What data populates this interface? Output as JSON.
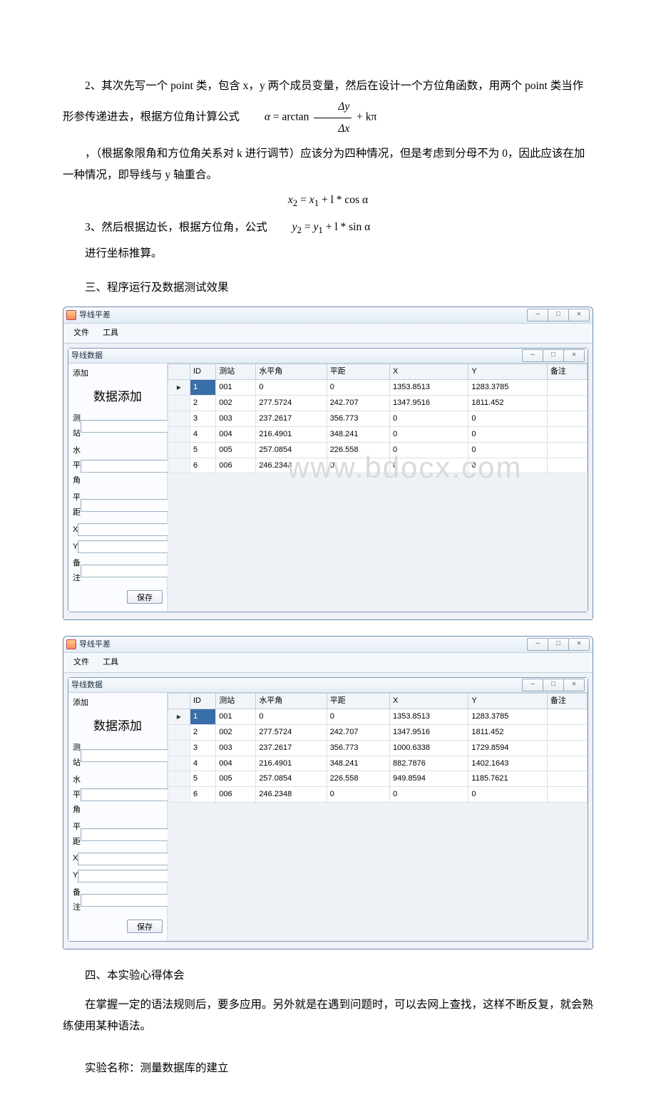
{
  "para": {
    "p1_lead": "2、其次先写一个 point 类，包含 x，y 两个成员变量，然后在设计一个方位角函数，用两个 point 类当作形参传递进去，根据方位角计算公式",
    "p1_tail": "",
    "p2": "，（根据象限角和方位角关系对 k 进行调节）应该分为四种情况，但是考虑到分母不为 0，因此应该在加一种情况，即导线与 y 轴重合。",
    "p3_lead": "3、然后根据边长，根据方位角，公式",
    "p4": "进行坐标推算。",
    "h3": "三、程序运行及数据测试效果",
    "h4": "四、本实验心得体会",
    "p5": "在掌握一定的语法规则后，要多应用。另外就是在遇到问题时，可以去网上查找，这样不断反复，就会熟练使用某种语法。",
    "p6": "实验名称：测量数据库的建立"
  },
  "formula": {
    "azimuth_lhs": "α",
    "azimuth_op": "= arctan",
    "dy": "Δy",
    "dx": "Δx",
    "kpi": "+ kπ",
    "x2": "x",
    "sub2": "2",
    "eq": " = ",
    "x1": "x",
    "sub1": "1",
    "plus_l": " + l * ",
    "cosA": "cos α",
    "y2": "y",
    "y1": "y",
    "sinA": "sin α"
  },
  "app": {
    "main_title": "导线平差",
    "menu_file": "文件",
    "menu_tool": "工具",
    "child_title": "导线数据",
    "side_add": "添加",
    "side_big": "数据添加",
    "lbl_station": "测站",
    "lbl_hang": "水平角",
    "lbl_dist": "平距",
    "lbl_x": "X",
    "lbl_y": "Y",
    "lbl_note": "备注",
    "save": "保存",
    "watermark": "www.bdocx.com"
  },
  "cols": [
    "ID",
    "测站",
    "水平角",
    "平距",
    "X",
    "Y",
    "备注"
  ],
  "rows1": [
    {
      "id": "1",
      "st": "001",
      "h": "0",
      "d": "0",
      "x": "1353.8513",
      "y": "1283.3785",
      "n": ""
    },
    {
      "id": "2",
      "st": "002",
      "h": "277.5724",
      "d": "242.707",
      "x": "1347.9516",
      "y": "1811.452",
      "n": ""
    },
    {
      "id": "3",
      "st": "003",
      "h": "237.2617",
      "d": "356.773",
      "x": "0",
      "y": "0",
      "n": ""
    },
    {
      "id": "4",
      "st": "004",
      "h": "216.4901",
      "d": "348.241",
      "x": "0",
      "y": "0",
      "n": ""
    },
    {
      "id": "5",
      "st": "005",
      "h": "257.0854",
      "d": "226.558",
      "x": "0",
      "y": "0",
      "n": ""
    },
    {
      "id": "6",
      "st": "006",
      "h": "246.2348",
      "d": "0",
      "x": "0",
      "y": "0",
      "n": ""
    }
  ],
  "rows2": [
    {
      "id": "1",
      "st": "001",
      "h": "0",
      "d": "0",
      "x": "1353.8513",
      "y": "1283.3785",
      "n": ""
    },
    {
      "id": "2",
      "st": "002",
      "h": "277.5724",
      "d": "242.707",
      "x": "1347.9516",
      "y": "1811.452",
      "n": ""
    },
    {
      "id": "3",
      "st": "003",
      "h": "237.2617",
      "d": "356.773",
      "x": "1000.6338",
      "y": "1729.8594",
      "n": ""
    },
    {
      "id": "4",
      "st": "004",
      "h": "216.4901",
      "d": "348.241",
      "x": "882.7876",
      "y": "1402.1643",
      "n": ""
    },
    {
      "id": "5",
      "st": "005",
      "h": "257.0854",
      "d": "226.558",
      "x": "949.8594",
      "y": "1185.7621",
      "n": ""
    },
    {
      "id": "6",
      "st": "006",
      "h": "246.2348",
      "d": "0",
      "x": "0",
      "y": "0",
      "n": ""
    }
  ],
  "chart_data": [
    {
      "type": "table",
      "title": "导线数据 (before)",
      "columns": [
        "ID",
        "测站",
        "水平角",
        "平距",
        "X",
        "Y",
        "备注"
      ],
      "rows": [
        [
          "1",
          "001",
          "0",
          "0",
          "1353.8513",
          "1283.3785",
          ""
        ],
        [
          "2",
          "002",
          "277.5724",
          "242.707",
          "1347.9516",
          "1811.452",
          ""
        ],
        [
          "3",
          "003",
          "237.2617",
          "356.773",
          "0",
          "0",
          ""
        ],
        [
          "4",
          "004",
          "216.4901",
          "348.241",
          "0",
          "0",
          ""
        ],
        [
          "5",
          "005",
          "257.0854",
          "226.558",
          "0",
          "0",
          ""
        ],
        [
          "6",
          "006",
          "246.2348",
          "0",
          "0",
          "0",
          ""
        ]
      ]
    },
    {
      "type": "table",
      "title": "导线数据 (after)",
      "columns": [
        "ID",
        "测站",
        "水平角",
        "平距",
        "X",
        "Y",
        "备注"
      ],
      "rows": [
        [
          "1",
          "001",
          "0",
          "0",
          "1353.8513",
          "1283.3785",
          ""
        ],
        [
          "2",
          "002",
          "277.5724",
          "242.707",
          "1347.9516",
          "1811.452",
          ""
        ],
        [
          "3",
          "003",
          "237.2617",
          "356.773",
          "1000.6338",
          "1729.8594",
          ""
        ],
        [
          "4",
          "004",
          "216.4901",
          "348.241",
          "882.7876",
          "1402.1643",
          ""
        ],
        [
          "5",
          "005",
          "257.0854",
          "226.558",
          "949.8594",
          "1185.7621",
          ""
        ],
        [
          "6",
          "006",
          "246.2348",
          "0",
          "0",
          "0",
          ""
        ]
      ]
    }
  ]
}
